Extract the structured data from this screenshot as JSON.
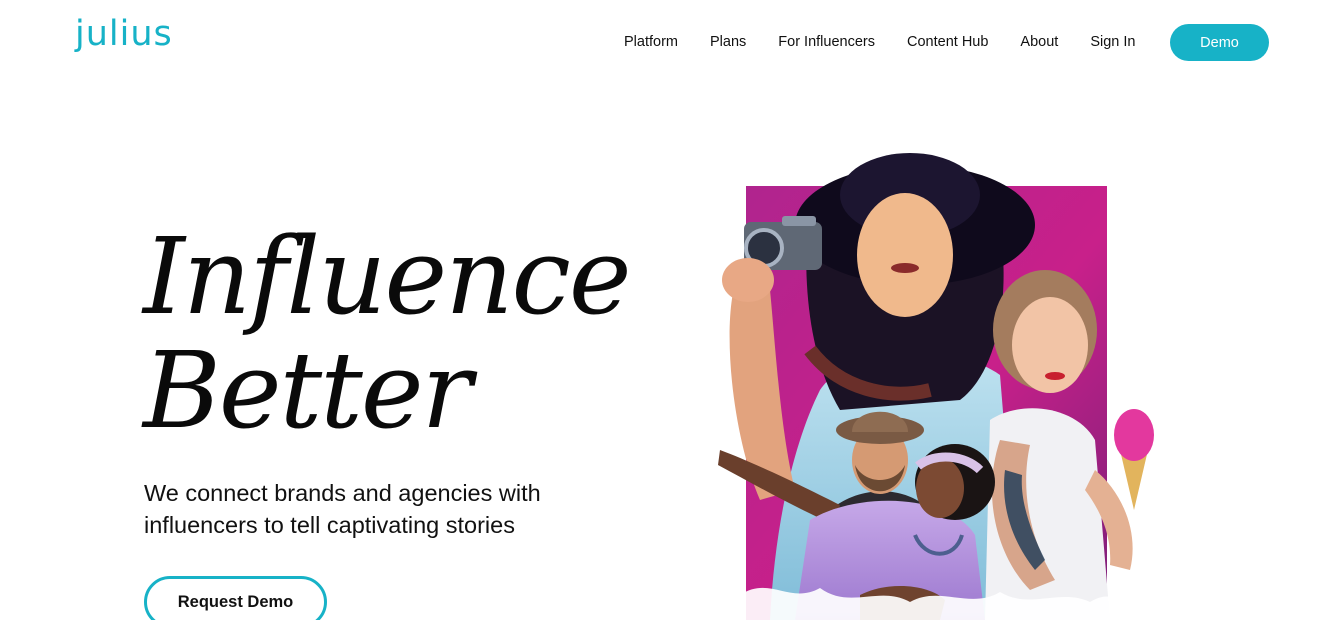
{
  "brand": {
    "name": "julius",
    "accent_color": "#17b2c7"
  },
  "nav": {
    "items": [
      "Platform",
      "Plans",
      "For Influencers",
      "Content Hub",
      "About",
      "Sign In"
    ],
    "demo_label": "Demo"
  },
  "hero": {
    "headline_line1": "Influence",
    "headline_line2": "Better",
    "subtext": "We connect brands and agencies with influencers to tell captivating stories",
    "cta_label": "Request Demo",
    "image_backdrop_color": "#c01f8a"
  }
}
